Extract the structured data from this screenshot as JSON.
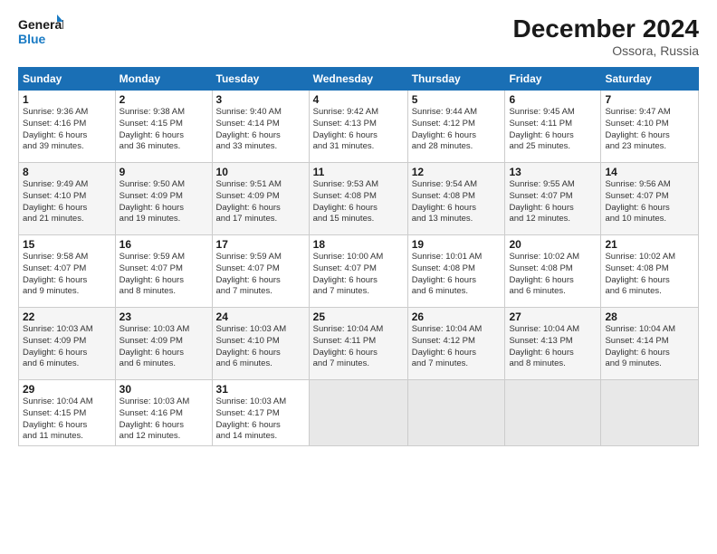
{
  "header": {
    "logo": {
      "line1": "General",
      "line2": "Blue"
    },
    "title": "December 2024",
    "location": "Ossora, Russia"
  },
  "days_of_week": [
    "Sunday",
    "Monday",
    "Tuesday",
    "Wednesday",
    "Thursday",
    "Friday",
    "Saturday"
  ],
  "weeks": [
    [
      {
        "day": "1",
        "info": "Sunrise: 9:36 AM\nSunset: 4:16 PM\nDaylight: 6 hours\nand 39 minutes."
      },
      {
        "day": "2",
        "info": "Sunrise: 9:38 AM\nSunset: 4:15 PM\nDaylight: 6 hours\nand 36 minutes."
      },
      {
        "day": "3",
        "info": "Sunrise: 9:40 AM\nSunset: 4:14 PM\nDaylight: 6 hours\nand 33 minutes."
      },
      {
        "day": "4",
        "info": "Sunrise: 9:42 AM\nSunset: 4:13 PM\nDaylight: 6 hours\nand 31 minutes."
      },
      {
        "day": "5",
        "info": "Sunrise: 9:44 AM\nSunset: 4:12 PM\nDaylight: 6 hours\nand 28 minutes."
      },
      {
        "day": "6",
        "info": "Sunrise: 9:45 AM\nSunset: 4:11 PM\nDaylight: 6 hours\nand 25 minutes."
      },
      {
        "day": "7",
        "info": "Sunrise: 9:47 AM\nSunset: 4:10 PM\nDaylight: 6 hours\nand 23 minutes."
      }
    ],
    [
      {
        "day": "8",
        "info": "Sunrise: 9:49 AM\nSunset: 4:10 PM\nDaylight: 6 hours\nand 21 minutes."
      },
      {
        "day": "9",
        "info": "Sunrise: 9:50 AM\nSunset: 4:09 PM\nDaylight: 6 hours\nand 19 minutes."
      },
      {
        "day": "10",
        "info": "Sunrise: 9:51 AM\nSunset: 4:09 PM\nDaylight: 6 hours\nand 17 minutes."
      },
      {
        "day": "11",
        "info": "Sunrise: 9:53 AM\nSunset: 4:08 PM\nDaylight: 6 hours\nand 15 minutes."
      },
      {
        "day": "12",
        "info": "Sunrise: 9:54 AM\nSunset: 4:08 PM\nDaylight: 6 hours\nand 13 minutes."
      },
      {
        "day": "13",
        "info": "Sunrise: 9:55 AM\nSunset: 4:07 PM\nDaylight: 6 hours\nand 12 minutes."
      },
      {
        "day": "14",
        "info": "Sunrise: 9:56 AM\nSunset: 4:07 PM\nDaylight: 6 hours\nand 10 minutes."
      }
    ],
    [
      {
        "day": "15",
        "info": "Sunrise: 9:58 AM\nSunset: 4:07 PM\nDaylight: 6 hours\nand 9 minutes."
      },
      {
        "day": "16",
        "info": "Sunrise: 9:59 AM\nSunset: 4:07 PM\nDaylight: 6 hours\nand 8 minutes."
      },
      {
        "day": "17",
        "info": "Sunrise: 9:59 AM\nSunset: 4:07 PM\nDaylight: 6 hours\nand 7 minutes."
      },
      {
        "day": "18",
        "info": "Sunrise: 10:00 AM\nSunset: 4:07 PM\nDaylight: 6 hours\nand 7 minutes."
      },
      {
        "day": "19",
        "info": "Sunrise: 10:01 AM\nSunset: 4:08 PM\nDaylight: 6 hours\nand 6 minutes."
      },
      {
        "day": "20",
        "info": "Sunrise: 10:02 AM\nSunset: 4:08 PM\nDaylight: 6 hours\nand 6 minutes."
      },
      {
        "day": "21",
        "info": "Sunrise: 10:02 AM\nSunset: 4:08 PM\nDaylight: 6 hours\nand 6 minutes."
      }
    ],
    [
      {
        "day": "22",
        "info": "Sunrise: 10:03 AM\nSunset: 4:09 PM\nDaylight: 6 hours\nand 6 minutes."
      },
      {
        "day": "23",
        "info": "Sunrise: 10:03 AM\nSunset: 4:09 PM\nDaylight: 6 hours\nand 6 minutes."
      },
      {
        "day": "24",
        "info": "Sunrise: 10:03 AM\nSunset: 4:10 PM\nDaylight: 6 hours\nand 6 minutes."
      },
      {
        "day": "25",
        "info": "Sunrise: 10:04 AM\nSunset: 4:11 PM\nDaylight: 6 hours\nand 7 minutes."
      },
      {
        "day": "26",
        "info": "Sunrise: 10:04 AM\nSunset: 4:12 PM\nDaylight: 6 hours\nand 7 minutes."
      },
      {
        "day": "27",
        "info": "Sunrise: 10:04 AM\nSunset: 4:13 PM\nDaylight: 6 hours\nand 8 minutes."
      },
      {
        "day": "28",
        "info": "Sunrise: 10:04 AM\nSunset: 4:14 PM\nDaylight: 6 hours\nand 9 minutes."
      }
    ],
    [
      {
        "day": "29",
        "info": "Sunrise: 10:04 AM\nSunset: 4:15 PM\nDaylight: 6 hours\nand 11 minutes."
      },
      {
        "day": "30",
        "info": "Sunrise: 10:03 AM\nSunset: 4:16 PM\nDaylight: 6 hours\nand 12 minutes."
      },
      {
        "day": "31",
        "info": "Sunrise: 10:03 AM\nSunset: 4:17 PM\nDaylight: 6 hours\nand 14 minutes."
      },
      null,
      null,
      null,
      null
    ]
  ]
}
